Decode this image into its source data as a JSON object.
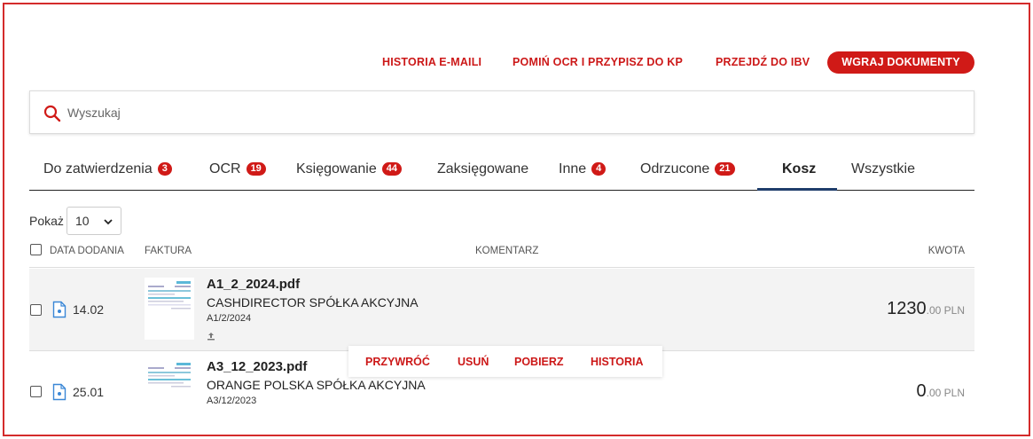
{
  "toolbar": {
    "email_history": "HISTORIA E-MAILI",
    "skip_ocr": "POMIŃ OCR I PRZYPISZ DO KP",
    "go_ibv": "PRZEJDŹ DO IBV",
    "upload": "WGRAJ DOKUMENTY"
  },
  "search": {
    "placeholder": "Wyszukaj",
    "value": ""
  },
  "tabs": [
    {
      "label": "Do zatwierdzenia",
      "badge": "3"
    },
    {
      "label": "OCR",
      "badge": "19"
    },
    {
      "label": "Księgowanie",
      "badge": "44"
    },
    {
      "label": "Zaksięgowane",
      "badge": ""
    },
    {
      "label": "Inne",
      "badge": "4"
    },
    {
      "label": "Odrzucone",
      "badge": "21"
    },
    {
      "label": "Kosz",
      "badge": "",
      "active": true
    },
    {
      "label": "Wszystkie",
      "badge": ""
    }
  ],
  "pagination": {
    "show_label": "Pokaż",
    "page_size": "10"
  },
  "table": {
    "columns": {
      "date": "DATA DODANIA",
      "invoice": "FAKTURA",
      "comment": "KOMENTARZ",
      "amount": "KWOTA"
    },
    "rows": [
      {
        "date": "14.02",
        "file": "A1_2_2024.pdf",
        "company": "CASHDIRECTOR SPÓŁKA AKCYJNA",
        "invoice_no": "A1/2/2024",
        "amount_main": "1230",
        "amount_rest": ".00 PLN"
      },
      {
        "date": "25.01",
        "file": "A3_12_2023.pdf",
        "company": "ORANGE POLSKA SPÓŁKA AKCYJNA",
        "invoice_no": "A3/12/2023",
        "amount_main": "0",
        "amount_rest": ".00 PLN"
      }
    ]
  },
  "row_actions": {
    "restore": "PRZYWRÓĆ",
    "delete": "USUŃ",
    "download": "POBIERZ",
    "history": "HISTORIA"
  },
  "colors": {
    "accent": "#d01a17",
    "tab_underline": "#1f3d6b",
    "frame": "#d42b2b"
  }
}
